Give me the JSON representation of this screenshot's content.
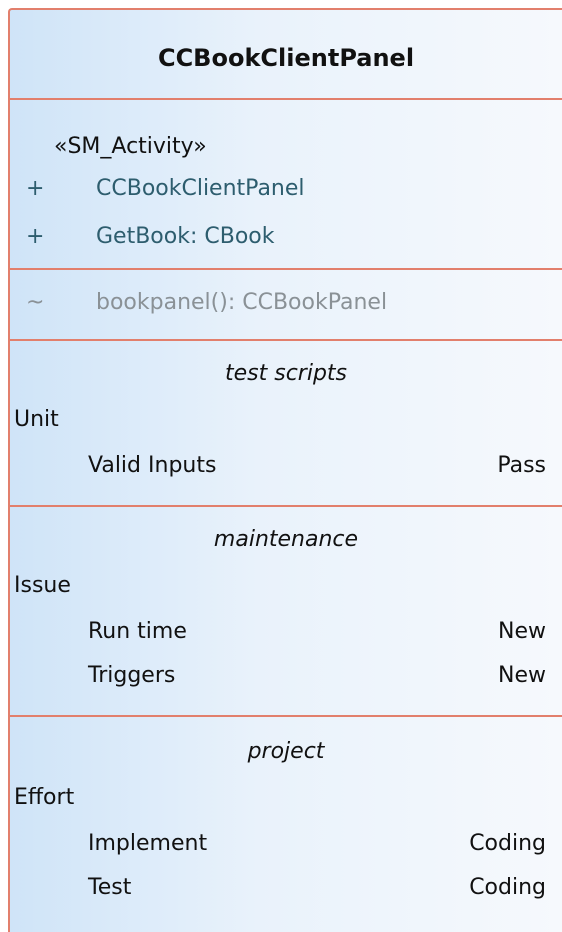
{
  "class_name": "CCBookClientPanel",
  "attributes": {
    "stereotype": "«SM_Activity»",
    "items": [
      {
        "visibility": "+",
        "text": "CCBookClientPanel"
      },
      {
        "visibility": "+",
        "text": "GetBook: CBook"
      }
    ]
  },
  "operations": {
    "items": [
      {
        "visibility": "~",
        "text": "bookpanel(): CCBookPanel"
      }
    ]
  },
  "test_scripts": {
    "title": "test scripts",
    "group": "Unit",
    "rows": [
      {
        "name": "Valid Inputs",
        "status": "Pass"
      }
    ]
  },
  "maintenance": {
    "title": "maintenance",
    "group": "Issue",
    "rows": [
      {
        "name": "Run time",
        "status": "New"
      },
      {
        "name": "Triggers",
        "status": "New"
      }
    ]
  },
  "project": {
    "title": "project",
    "group": "Effort",
    "rows": [
      {
        "name": "Implement",
        "status": "Coding"
      },
      {
        "name": "Test",
        "status": "Coding"
      }
    ]
  },
  "colors": {
    "border": "#e27f6c",
    "fill_left": "#cfe4f8",
    "fill_right": "#f6f9fd",
    "member_text": "#2d5d6e",
    "faded_text": "#8a9196"
  }
}
